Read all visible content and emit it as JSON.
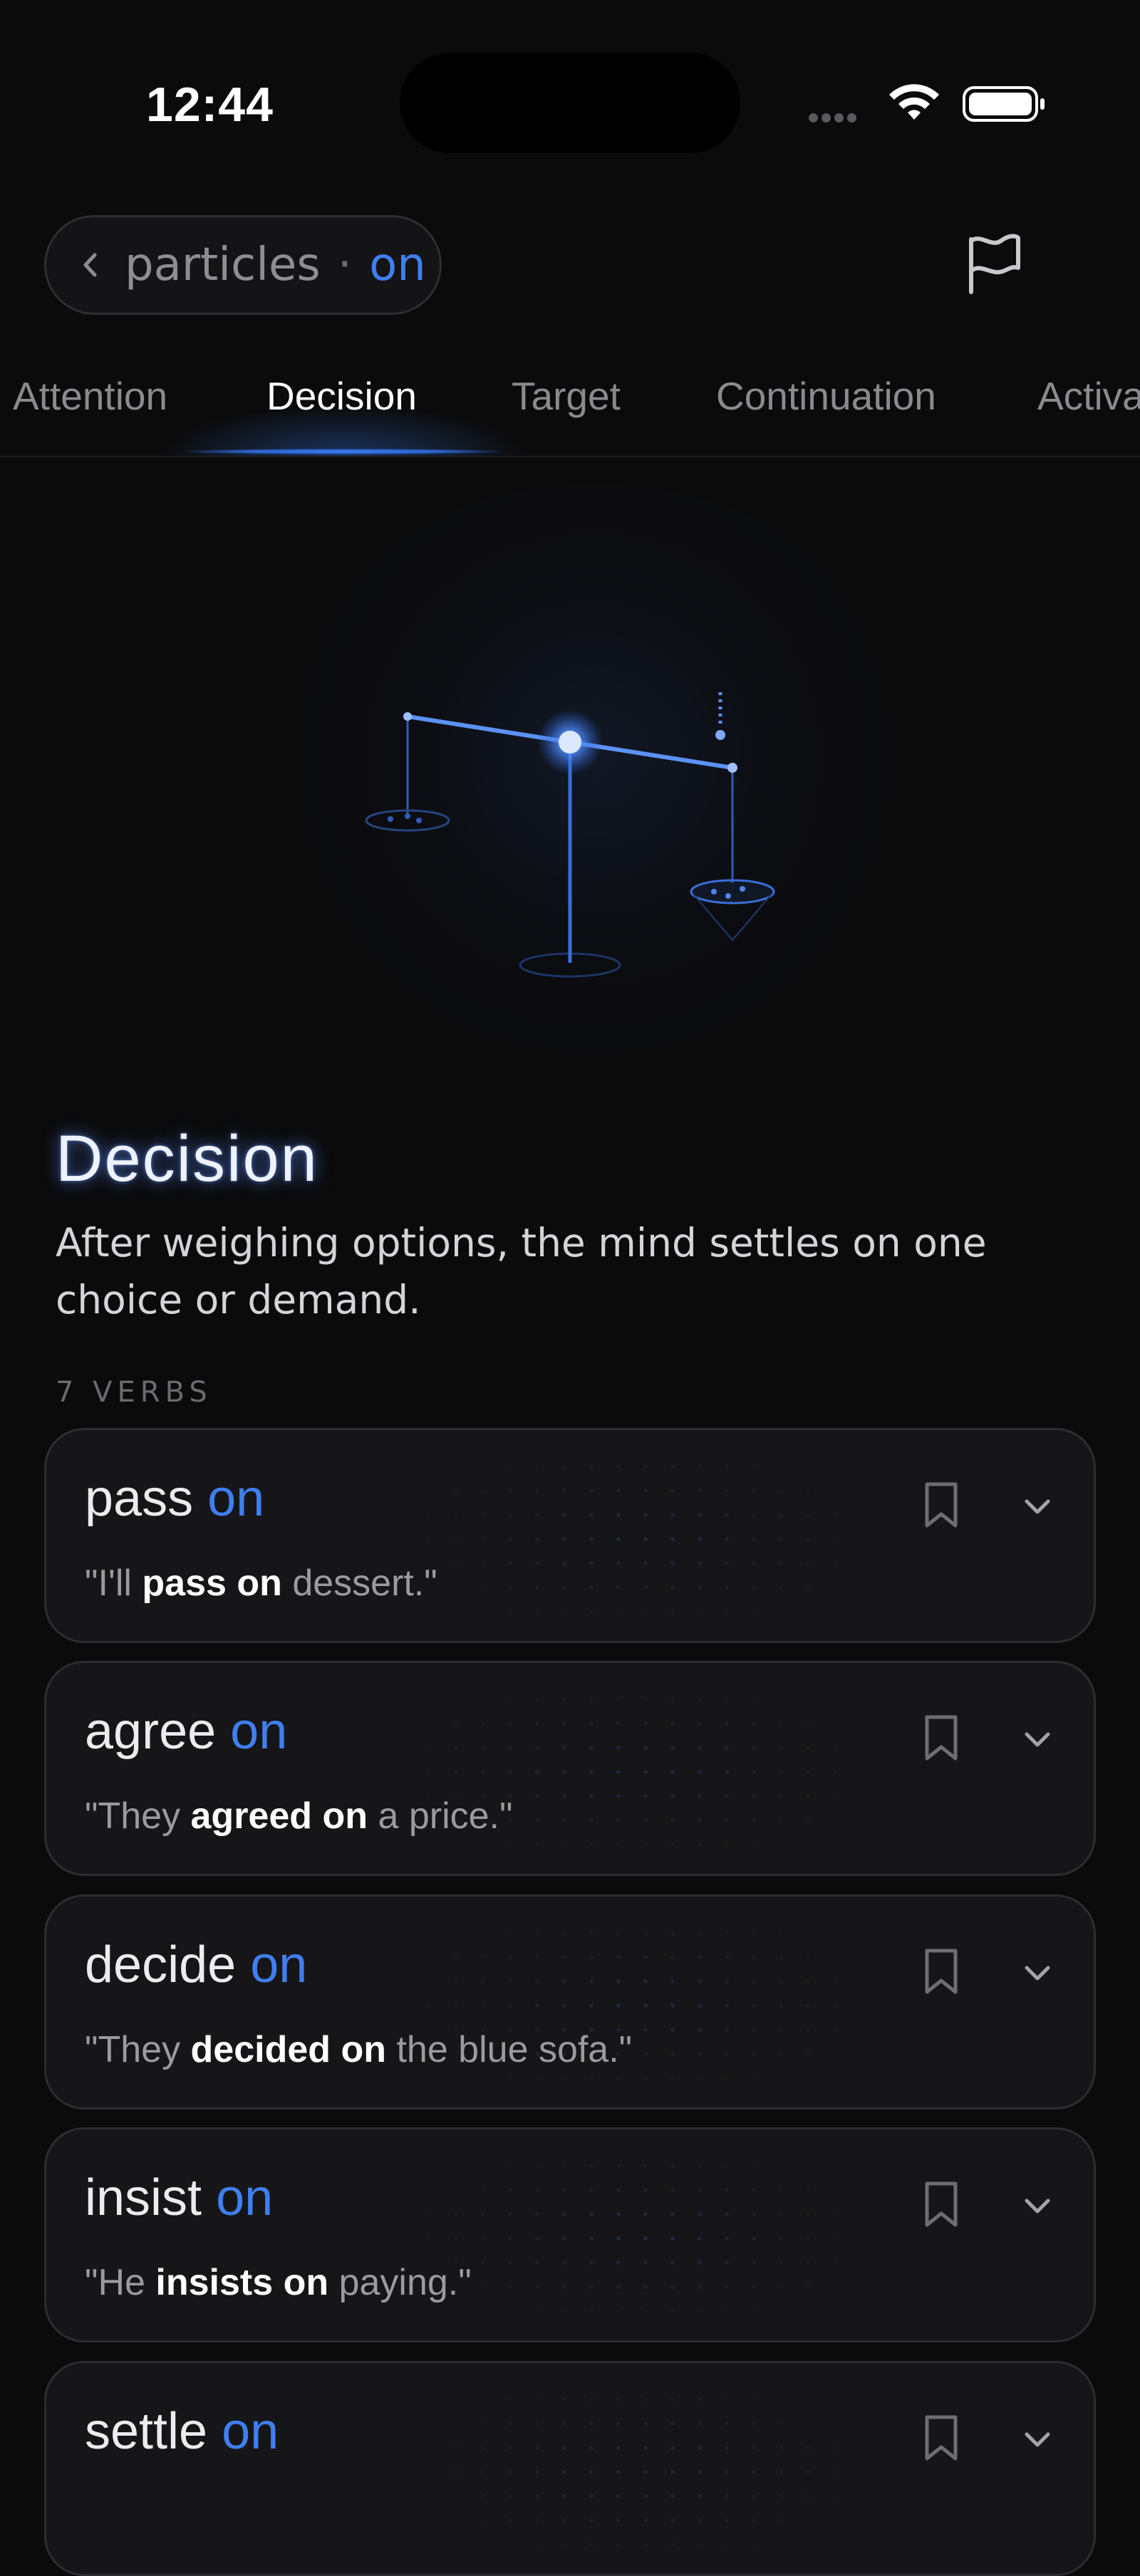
{
  "status_bar": {
    "time": "12:44"
  },
  "header": {
    "back_label": "particles",
    "separator": "·",
    "particle": "on"
  },
  "tabs": [
    {
      "label": "Attention",
      "active": false
    },
    {
      "label": "Decision",
      "active": true
    },
    {
      "label": "Target",
      "active": false
    },
    {
      "label": "Continuation",
      "active": false
    },
    {
      "label": "Activa",
      "active": false
    }
  ],
  "section": {
    "title": "Decision",
    "description": "After weighing options, the mind settles on one choice or demand.",
    "count_label": "7 VERBS"
  },
  "verbs": [
    {
      "verb": "pass",
      "particle": "on",
      "ex_before": "\"I'll ",
      "ex_bold": "pass on",
      "ex_after": " dessert.\""
    },
    {
      "verb": "agree",
      "particle": "on",
      "ex_before": "\"They ",
      "ex_bold": "agreed on",
      "ex_after": " a price.\""
    },
    {
      "verb": "decide",
      "particle": "on",
      "ex_before": "\"They ",
      "ex_bold": "decided on",
      "ex_after": " the blue sofa.\""
    },
    {
      "verb": "insist",
      "particle": "on",
      "ex_before": "\"He ",
      "ex_bold": "insists on",
      "ex_after": " paying.\""
    },
    {
      "verb": "settle",
      "particle": "on",
      "ex_before": "",
      "ex_bold": "",
      "ex_after": ""
    }
  ],
  "icons": {
    "back": "chevron-left-icon",
    "flag": "flag-icon",
    "bookmark": "bookmark-icon",
    "expand": "chevron-down-icon",
    "illustration": "balance-scale-illustration"
  },
  "colors": {
    "background": "#0b0b0c",
    "accent": "#3f7ff0",
    "card": "#161618",
    "card_border": "#2d2d31"
  }
}
